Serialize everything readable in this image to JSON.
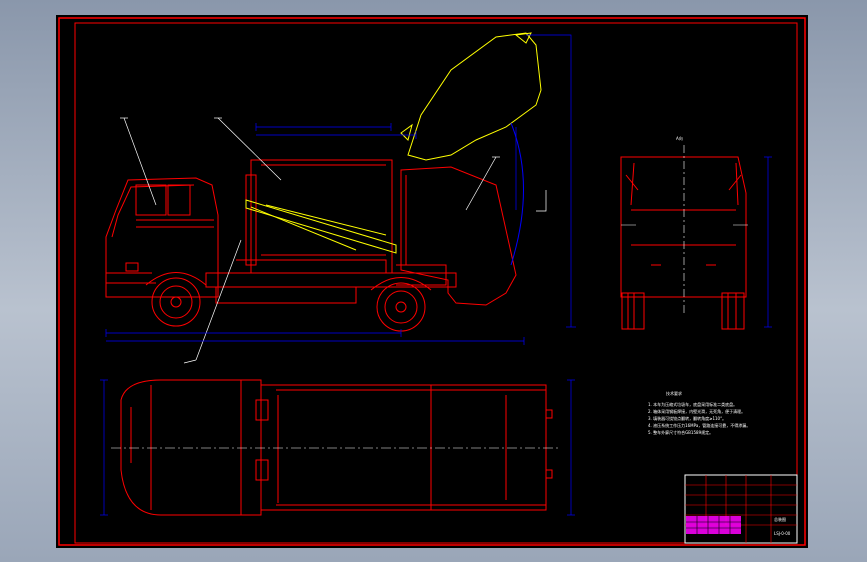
{
  "drawing": {
    "top_view_title": "A向",
    "notes_title": "技术要求",
    "notes": [
      "1. 本车为压缩式垃圾车，底盘采用标准二类底盘。",
      "2. 箱体采用钢板焊接，内壁光滑，无死角，便于清理。",
      "3. 填装器可绕铰点翻转，翻转角度≥110°。",
      "4. 液压系统工作压力16MPa，管路连接可靠，不得渗漏。",
      "5. 整车外廓尺寸符合GB1589规定。"
    ],
    "title_block": {
      "drawing_name": "总装图",
      "drawing_number": "LSJ-0-00"
    },
    "colors": {
      "background": "#000000",
      "outline": "#ff0000",
      "structure": "#ffff00",
      "dimension": "#0000ff",
      "centerline": "#ffffff",
      "stamp": "#ff00ff"
    }
  }
}
